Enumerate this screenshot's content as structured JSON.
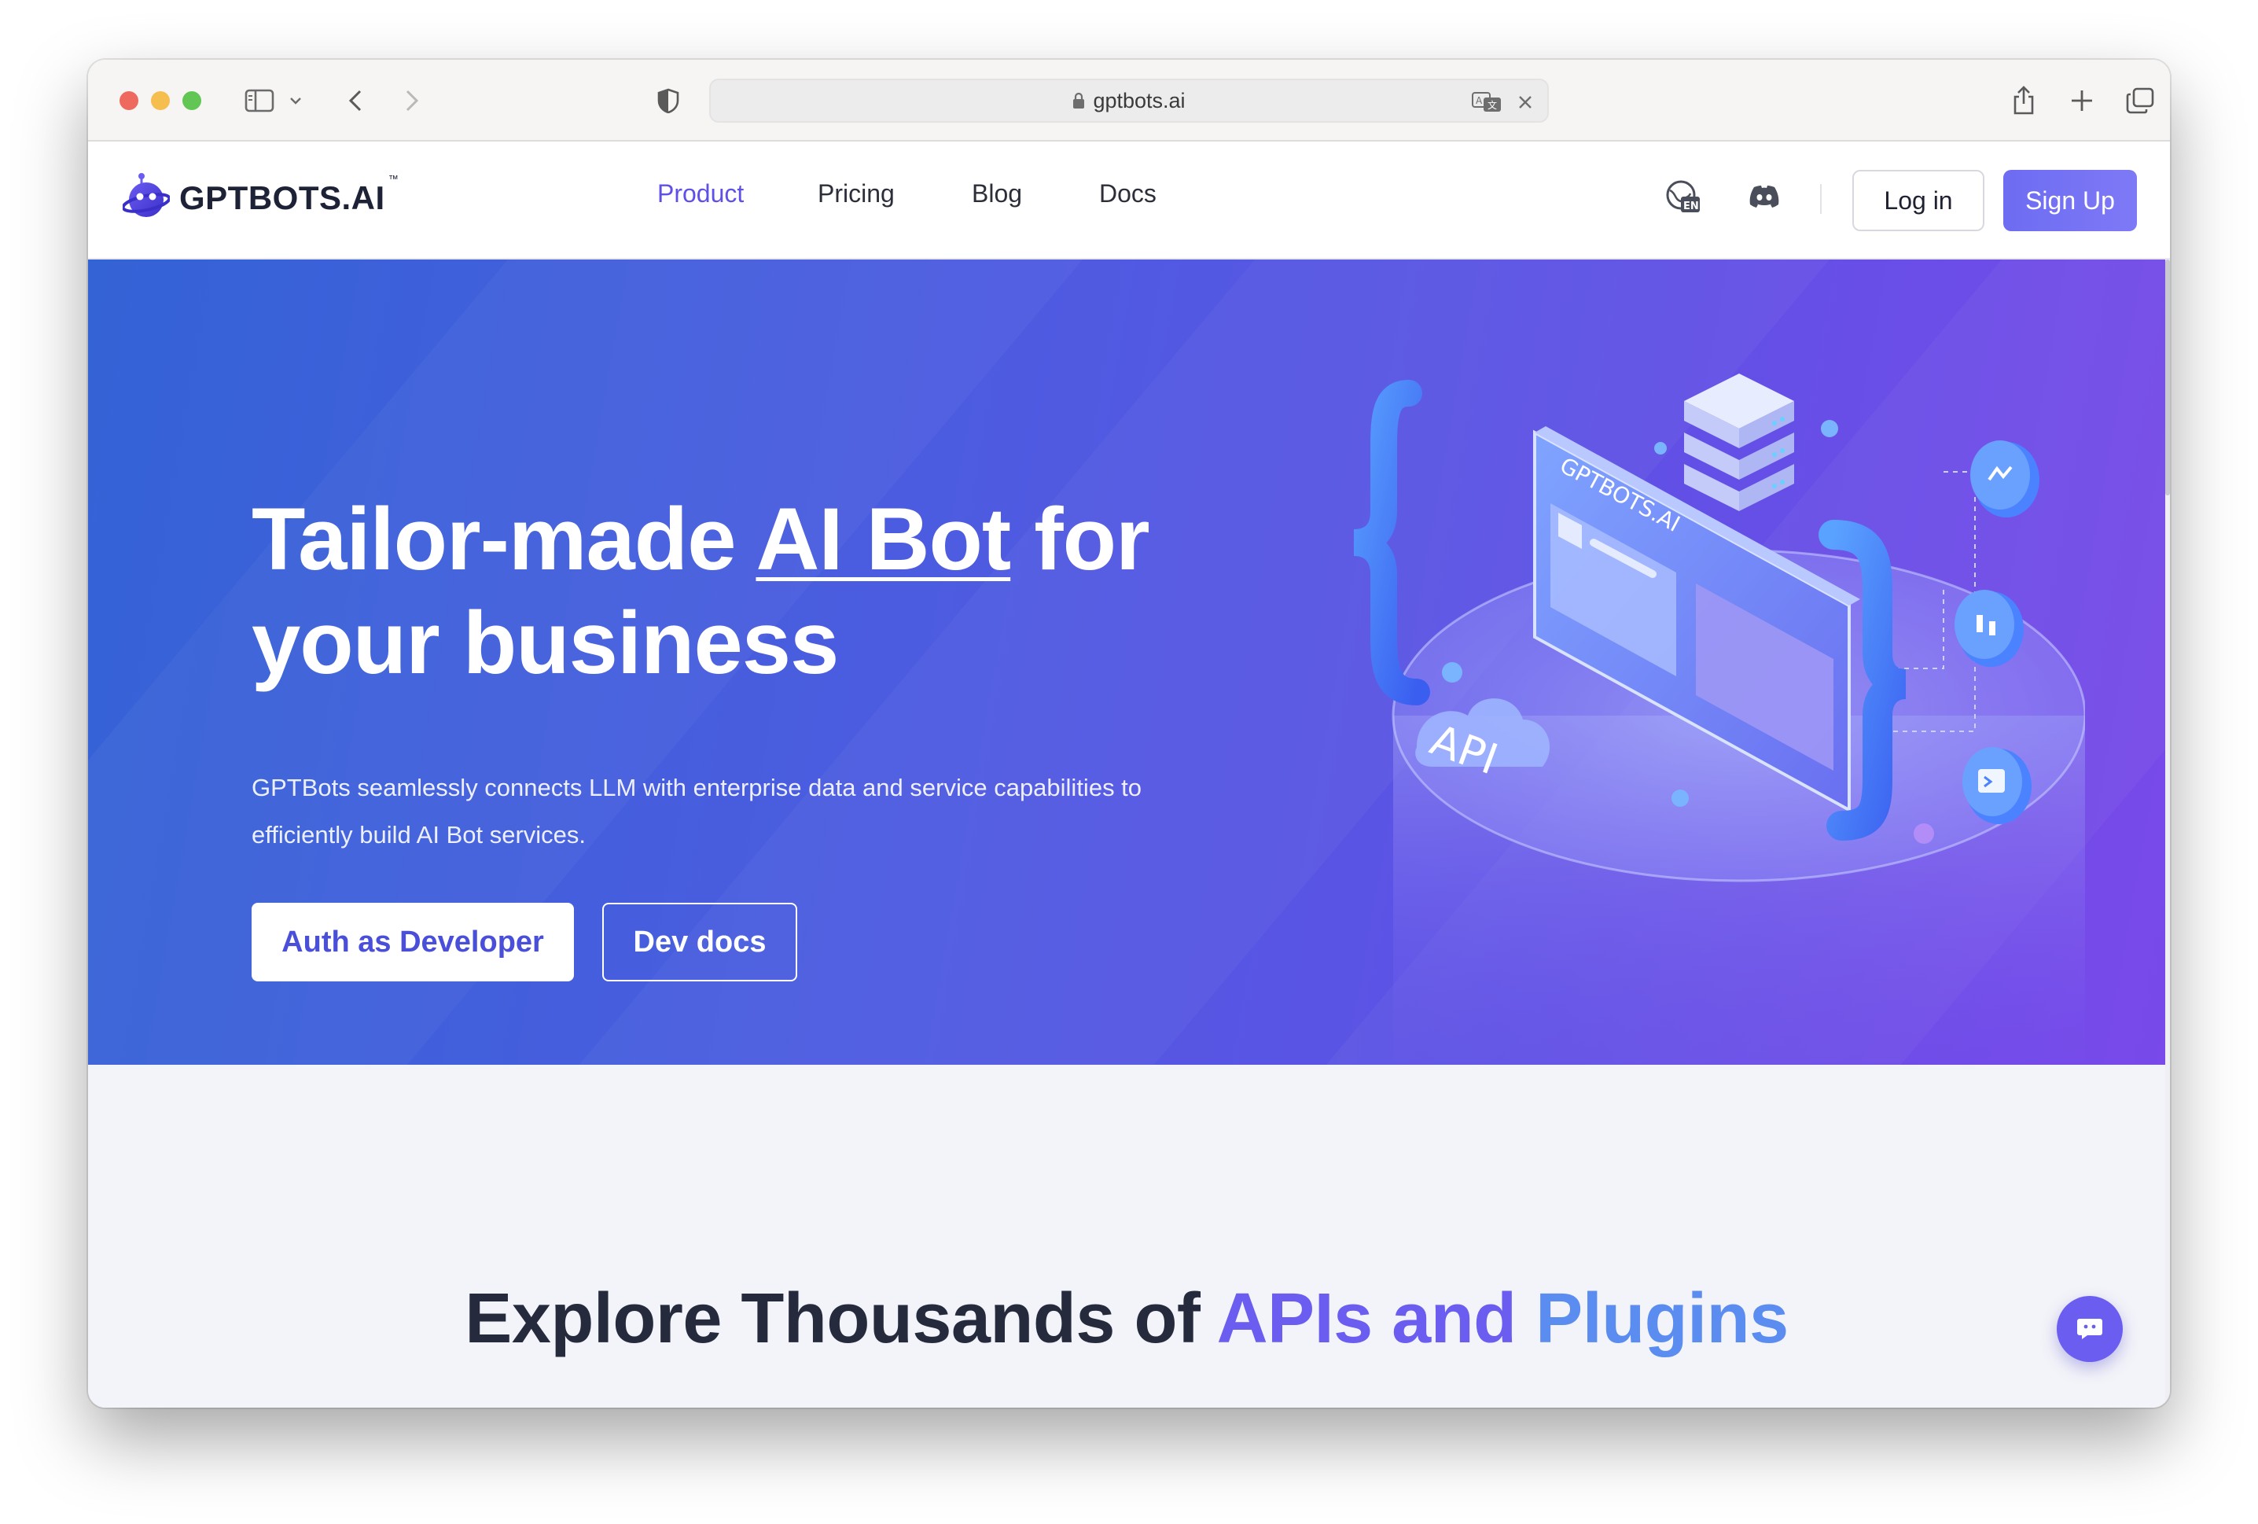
{
  "browser": {
    "url": "gptbots.ai"
  },
  "header": {
    "logo_text": "GPTBOTS.AI",
    "logo_tm": "™",
    "nav": [
      {
        "label": "Product",
        "active": true
      },
      {
        "label": "Pricing",
        "active": false
      },
      {
        "label": "Blog",
        "active": false
      },
      {
        "label": "Docs",
        "active": false
      }
    ],
    "language_icon": "language-en-icon",
    "discord_icon": "discord-icon",
    "login_label": "Log in",
    "signup_label": "Sign Up"
  },
  "hero": {
    "title_part1": "Tailor-made ",
    "title_highlight": "AI Bot",
    "title_part2": " for your business",
    "subtitle": "GPTBots seamlessly connects LLM with enterprise data and service capabilities to efficiently build AI Bot services.",
    "primary_button": "Auth as Developer",
    "secondary_button": "Dev docs",
    "art": {
      "screen_label": "GPTBOTS.AI",
      "cloud_label": "API"
    }
  },
  "section": {
    "title_part1": "Explore Thousands of ",
    "title_part2": "APIs and",
    "title_part3": " Plugins"
  },
  "colors": {
    "accent": "#5f51e6",
    "hero_start": "#3463d6",
    "hero_end": "#7949e9",
    "signup": "#6d6cf2"
  }
}
